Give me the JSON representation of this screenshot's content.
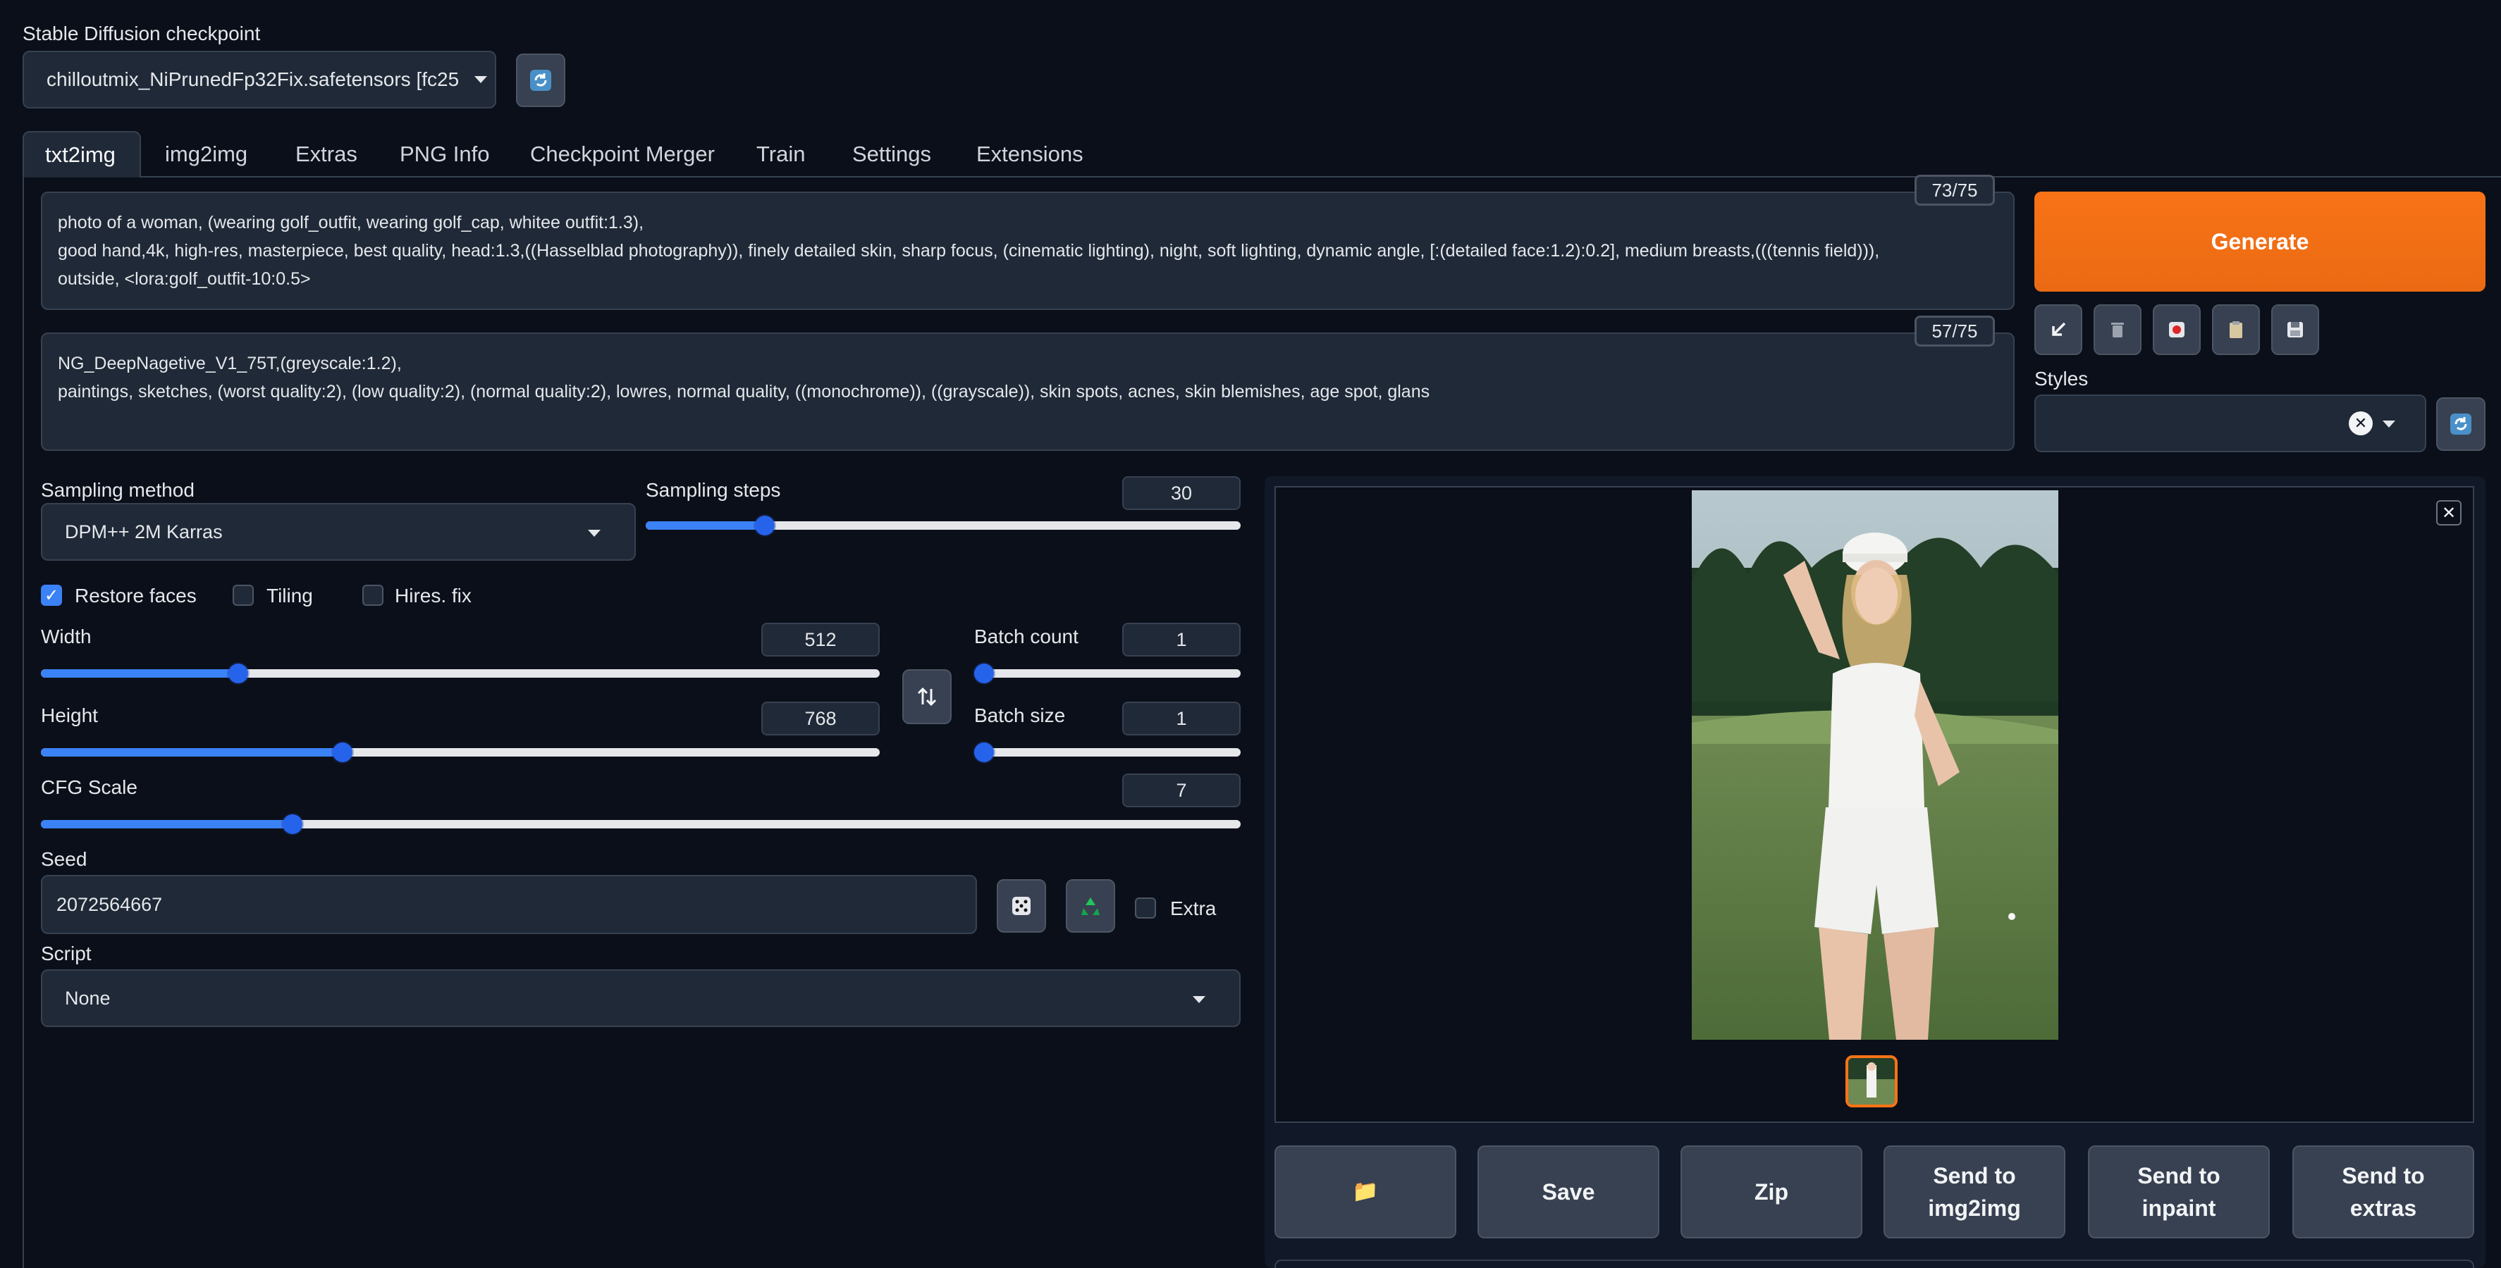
{
  "checkpoint": {
    "label": "Stable Diffusion checkpoint",
    "value": "chilloutmix_NiPrunedFp32Fix.safetensors [fc25",
    "refresh_icon": "refresh-icon"
  },
  "tabs": [
    "txt2img",
    "img2img",
    "Extras",
    "PNG Info",
    "Checkpoint Merger",
    "Train",
    "Settings",
    "Extensions"
  ],
  "active_tab": "txt2img",
  "prompt": {
    "lines": [
      "photo of a woman, (wearing golf_outfit, wearing golf_cap, whitee outfit:1.3),",
      "good hand,4k, high-res, masterpiece, best quality, head:1.3,((Hasselblad photography)), finely detailed skin, sharp focus, (cinematic lighting), night, soft lighting, dynamic angle, [:(detailed face:1.2):0.2], medium breasts,(((tennis field))),",
      "outside,   <lora:golf_outfit-10:0.5>"
    ],
    "token_count": "73/75"
  },
  "negative_prompt": {
    "lines": [
      "NG_DeepNagetive_V1_75T,(greyscale:1.2),",
      "paintings, sketches, (worst quality:2), (low quality:2), (normal quality:2), lowres, normal quality, ((monochrome)), ((grayscale)), skin spots, acnes, skin blemishes, age spot, glans"
    ],
    "token_count": "57/75"
  },
  "generate_label": "Generate",
  "tool_icons": [
    "arrow-down-left-icon",
    "trash-icon",
    "red-dot-icon",
    "clipboard-icon",
    "save-disk-icon"
  ],
  "styles": {
    "label": "Styles",
    "value": ""
  },
  "sampling_method": {
    "label": "Sampling method",
    "value": "DPM++ 2M Karras"
  },
  "sampling_steps": {
    "label": "Sampling steps",
    "value": "30",
    "fraction": 0.2
  },
  "restore_faces": {
    "label": "Restore faces",
    "checked": true
  },
  "tiling": {
    "label": "Tiling",
    "checked": false
  },
  "hires_fix": {
    "label": "Hires. fix",
    "checked": false
  },
  "width": {
    "label": "Width",
    "value": "512",
    "fraction": 0.235
  },
  "height": {
    "label": "Height",
    "value": "768",
    "fraction": 0.36
  },
  "batch_count": {
    "label": "Batch count",
    "value": "1",
    "fraction": 0.0
  },
  "batch_size": {
    "label": "Batch size",
    "value": "1",
    "fraction": 0.0
  },
  "cfg_scale": {
    "label": "CFG Scale",
    "value": "7",
    "fraction": 0.21
  },
  "seed": {
    "label": "Seed",
    "value": "2072564667",
    "extra_label": "Extra"
  },
  "script": {
    "label": "Script",
    "value": "None"
  },
  "output_buttons": [
    {
      "name": "open-folder-button",
      "label": "📁"
    },
    {
      "name": "save-button",
      "label": "Save"
    },
    {
      "name": "zip-button",
      "label": "Zip"
    },
    {
      "name": "send-to-img2img-button",
      "label": "Send to img2img"
    },
    {
      "name": "send-to-inpaint-button",
      "label": "Send to inpaint"
    },
    {
      "name": "send-to-extras-button",
      "label": "Send to extras"
    }
  ],
  "colors": {
    "background": "#0b0f19",
    "panel": "#1f2937",
    "accent_orange": "#f97316",
    "slider_blue": "#3b82f6"
  }
}
